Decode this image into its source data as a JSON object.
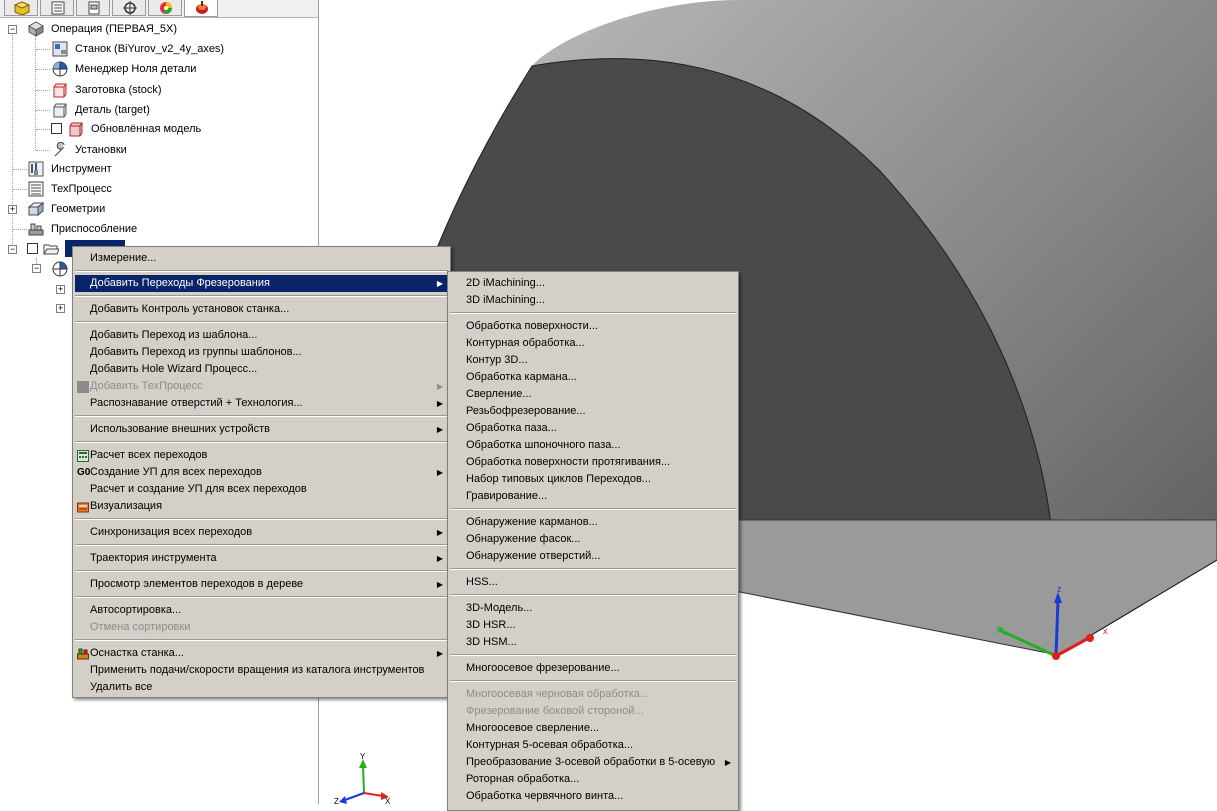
{
  "tree": {
    "items": [
      {
        "label": "Операция (ПЕРВАЯ_5X)"
      },
      {
        "label": "Станок (BiYurov_v2_4y_axes)"
      },
      {
        "label": "Менеджер Ноля детали"
      },
      {
        "label": "Заготовка (stock)"
      },
      {
        "label": "Деталь (target)"
      },
      {
        "label": "Обновлённая модель"
      },
      {
        "label": "Установки"
      },
      {
        "label": "Инструмент"
      },
      {
        "label": "ТехПроцесс"
      },
      {
        "label": "Геометрии"
      },
      {
        "label": "Приспособление"
      }
    ]
  },
  "context_menu": {
    "items": [
      {
        "label": "Измерение..."
      },
      {
        "label": "Добавить Переходы Фрезерования"
      },
      {
        "label": "Добавить Контроль установок станка..."
      },
      {
        "label": "Добавить Переход из шаблона..."
      },
      {
        "label": "Добавить Переход из группы шаблонов..."
      },
      {
        "label": "Добавить Hole Wizard Процесс..."
      },
      {
        "label": "Добавить ТехПроцесс"
      },
      {
        "label": "Распознавание отверстий + Технология..."
      },
      {
        "label": "Использование внешних устройств"
      },
      {
        "label": "Расчет всех переходов"
      },
      {
        "label": "Создание УП для всех переходов"
      },
      {
        "label": "Расчет и создание УП для всех переходов"
      },
      {
        "label": "Визуализация"
      },
      {
        "label": "Синхронизация всех переходов"
      },
      {
        "label": "Траектория инструмента"
      },
      {
        "label": "Просмотр элементов переходов в дереве"
      },
      {
        "label": "Автосортировка..."
      },
      {
        "label": "Отмена сортировки"
      },
      {
        "label": "Оснастка станка..."
      },
      {
        "label": "Применить подачи/скорости вращения из каталога инструментов"
      },
      {
        "label": "Удалить все"
      }
    ]
  },
  "submenu": {
    "items": [
      {
        "label": "2D iMachining..."
      },
      {
        "label": "3D iMachining..."
      },
      {
        "label": "Обработка поверхности..."
      },
      {
        "label": "Контурная обработка..."
      },
      {
        "label": "Контур 3D..."
      },
      {
        "label": "Обработка кармана..."
      },
      {
        "label": "Сверление..."
      },
      {
        "label": "Резьбофрезерование..."
      },
      {
        "label": "Обработка паза..."
      },
      {
        "label": "Обработка шпоночного паза..."
      },
      {
        "label": "Обработка поверхности протягивания..."
      },
      {
        "label": "Набор типовых циклов Переходов..."
      },
      {
        "label": "Гравирование..."
      },
      {
        "label": "Обнаружение карманов..."
      },
      {
        "label": "Обнаружение фасок..."
      },
      {
        "label": "Обнаружение отверстий..."
      },
      {
        "label": "HSS..."
      },
      {
        "label": "3D-Модель..."
      },
      {
        "label": "3D HSR..."
      },
      {
        "label": "3D HSM..."
      },
      {
        "label": "Многоосевое фрезерование..."
      },
      {
        "label": "Многоосевая черновая обработка..."
      },
      {
        "label": "Фрезерование боковой стороной..."
      },
      {
        "label": "Многоосевое сверление..."
      },
      {
        "label": "Контурная 5-осевая обработка..."
      },
      {
        "label": "Преобразование 3-осевой обработки в 5-осевую"
      },
      {
        "label": "Роторная обработка..."
      },
      {
        "label": "Обработка червячного винта..."
      }
    ]
  },
  "viewport": {
    "axis_labels": {
      "x": "x",
      "y": "y",
      "z": "z"
    },
    "triad_labels": {
      "x": "X",
      "y": "Y",
      "z": "Z"
    }
  },
  "colors": {
    "menu_bg": "#d4d0c8",
    "highlight": "#0a246a",
    "axis_x": "#e02020",
    "axis_y": "#22b022",
    "axis_z": "#1a3ad8"
  },
  "icons": [
    "part-icon",
    "feature-tree-icon",
    "property-icon",
    "crosshair-icon",
    "appearance-icon",
    "camworks-icon",
    "operation-icon",
    "machine-icon",
    "coordinate-icon",
    "stock-icon",
    "target-icon",
    "model-icon",
    "wrench-icon",
    "tool-icon",
    "list-icon",
    "geometry-icon",
    "fixture-icon",
    "folder-icon"
  ]
}
